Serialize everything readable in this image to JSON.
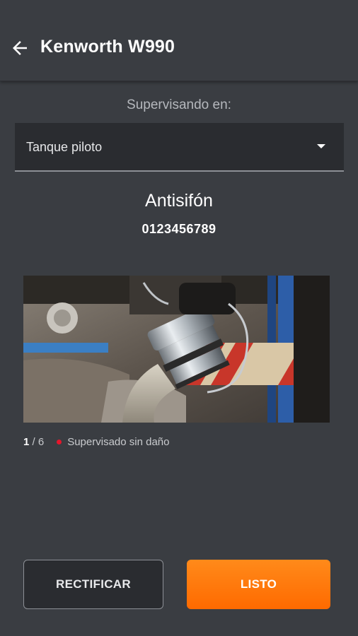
{
  "appbar": {
    "title": "Kenworth W990",
    "back_icon": "arrow-left-icon"
  },
  "supervision": {
    "label": "Supervisando en:",
    "selected": "Tanque piloto"
  },
  "item": {
    "name": "Antisifón",
    "code": "0123456789"
  },
  "photo": {
    "current": "1",
    "separator": " / ",
    "total": "6",
    "status_text": "Supervisado sin daño",
    "status_color": "#e5162b"
  },
  "actions": {
    "rectify_label": "RECTIFICAR",
    "done_label": "LISTO"
  },
  "colors": {
    "background": "#3a3d42",
    "accent": "#ff7a0d"
  }
}
